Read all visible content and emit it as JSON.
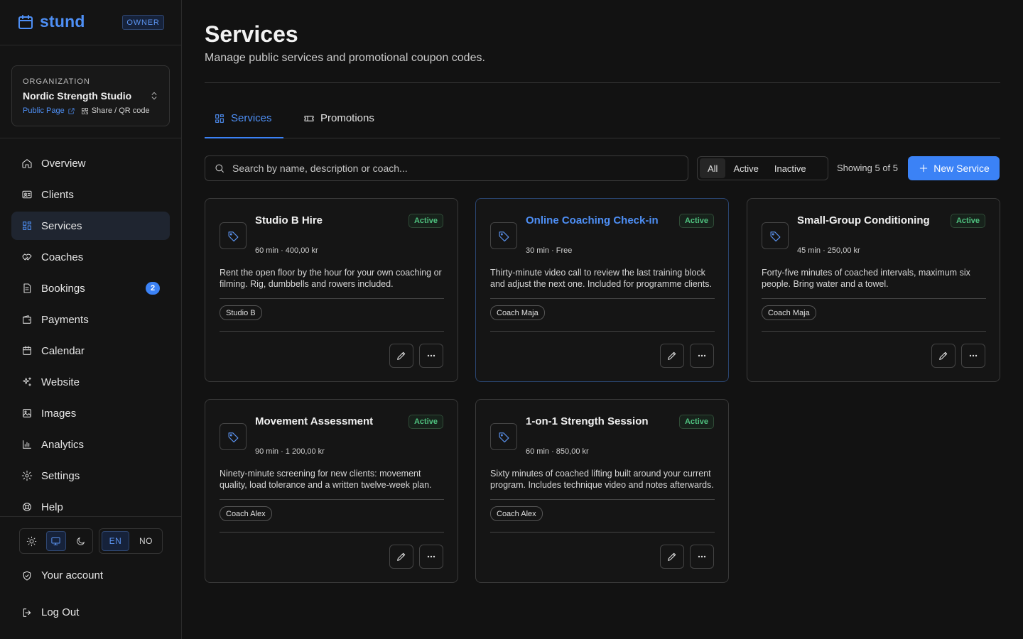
{
  "app": {
    "name": "stund",
    "role": "OWNER"
  },
  "organization": {
    "label": "ORGANIZATION",
    "name": "Nordic Strength Studio",
    "public_page": "Public Page",
    "share": "Share / QR code"
  },
  "nav": {
    "items": [
      {
        "label": "Overview",
        "icon": "home-icon"
      },
      {
        "label": "Clients",
        "icon": "id-card-icon"
      },
      {
        "label": "Services",
        "icon": "grid-icon",
        "active": true
      },
      {
        "label": "Coaches",
        "icon": "handshake-icon"
      },
      {
        "label": "Bookings",
        "icon": "file-icon",
        "badge": "2"
      },
      {
        "label": "Payments",
        "icon": "wallet-icon"
      },
      {
        "label": "Calendar",
        "icon": "calendar-icon"
      },
      {
        "label": "Website",
        "icon": "sparkles-icon"
      },
      {
        "label": "Images",
        "icon": "image-icon"
      },
      {
        "label": "Analytics",
        "icon": "bar-chart-icon"
      },
      {
        "label": "Settings",
        "icon": "gear-icon"
      },
      {
        "label": "Help",
        "icon": "lifebuoy-icon"
      }
    ],
    "account": "Your account",
    "logout": "Log Out"
  },
  "theme": {
    "options": [
      "light",
      "system",
      "dark"
    ],
    "selected": "system"
  },
  "language": {
    "options": [
      "EN",
      "NO"
    ],
    "selected": "EN"
  },
  "page": {
    "title": "Services",
    "subtitle": "Manage public services and promotional coupon codes."
  },
  "tabs": [
    {
      "label": "Services",
      "active": true
    },
    {
      "label": "Promotions",
      "active": false
    }
  ],
  "toolbar": {
    "search_placeholder": "Search by name, description or coach...",
    "filters": [
      "All",
      "Active",
      "Inactive"
    ],
    "selected_filter": "All",
    "showing": "Showing 5 of 5",
    "new_button": "New Service"
  },
  "services": [
    {
      "name": "Studio B Hire",
      "status": "Active",
      "meta": "60 min · 400,00 kr",
      "description": "Rent the open floor by the hour for your own coaching or filming. Rig, dumbbells and rowers included.",
      "tag": "Studio B"
    },
    {
      "name": "Online Coaching Check-in",
      "status": "Active",
      "meta": "30 min · Free",
      "description": "Thirty-minute video call to review the last training block and adjust the next one. Included for programme clients.",
      "tag": "Coach Maja",
      "highlighted": true
    },
    {
      "name": "Small-Group Conditioning",
      "status": "Active",
      "meta": "45 min · 250,00 kr",
      "description": "Forty-five minutes of coached intervals, maximum six people. Bring water and a towel.",
      "tag": "Coach Maja"
    },
    {
      "name": "Movement Assessment",
      "status": "Active",
      "meta": "90 min · 1 200,00 kr",
      "description": "Ninety-minute screening for new clients: movement quality, load tolerance and a written twelve-week plan.",
      "tag": "Coach Alex"
    },
    {
      "name": "1-on-1 Strength Session",
      "status": "Active",
      "meta": "60 min · 850,00 kr",
      "description": "Sixty minutes of coached lifting built around your current program. Includes technique video and notes afterwards.",
      "tag": "Coach Alex"
    }
  ],
  "colors": {
    "accent": "#3b82f6",
    "status_active": "#4fc27f",
    "background": "#121212"
  }
}
